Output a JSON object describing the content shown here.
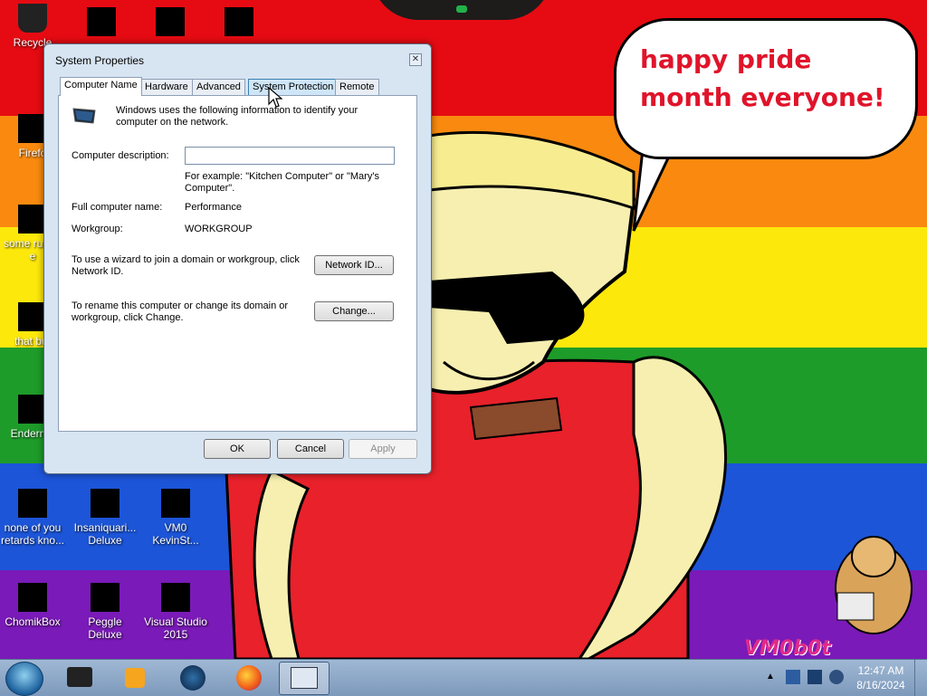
{
  "desktop": {
    "speech_bubble": "happy pride month everyone!",
    "mascot_label": "VM0b0t",
    "icons": [
      {
        "label": "Recycle",
        "name": "desktop-icon-recycle-bin"
      },
      {
        "label": "Firefo",
        "name": "desktop-icon-firefox"
      },
      {
        "label": "some ru ran e",
        "name": "desktop-icon-some-ru"
      },
      {
        "label": "that but",
        "name": "desktop-icon-that-but"
      },
      {
        "label": "Enderma",
        "name": "desktop-icon-enderma"
      },
      {
        "label": "none of you retards kno...",
        "name": "desktop-icon-none-of-you"
      },
      {
        "label": "Insaniquari... Deluxe",
        "name": "desktop-icon-insaniquarium"
      },
      {
        "label": "VM0 KevinSt...",
        "name": "desktop-icon-vm0-kevinst"
      },
      {
        "label": "ChomikBox",
        "name": "desktop-icon-chomikbox"
      },
      {
        "label": "Peggle Deluxe",
        "name": "desktop-icon-peggle"
      },
      {
        "label": "Visual Studio 2015",
        "name": "desktop-icon-visual-studio"
      }
    ]
  },
  "dialog": {
    "title": "System Properties",
    "tabs": [
      "Computer Name",
      "Hardware",
      "Advanced",
      "System Protection",
      "Remote"
    ],
    "intro": "Windows uses the following information to identify your computer on the network.",
    "description_label": "Computer description:",
    "description_value": "",
    "example": "For example: \"Kitchen Computer\" or \"Mary's Computer\".",
    "full_name_label": "Full computer name:",
    "full_name_value": "Performance",
    "workgroup_label": "Workgroup:",
    "workgroup_value": "WORKGROUP",
    "network_id_text": "To use a wizard to join a domain or workgroup, click Network ID.",
    "network_id_button": "Network ID...",
    "rename_text": "To rename this computer or change its domain or workgroup, click Change.",
    "change_button": "Change...",
    "ok_button": "OK",
    "cancel_button": "Cancel",
    "apply_button": "Apply"
  },
  "taskbar": {
    "time": "12:47 AM",
    "date": "8/16/2024"
  },
  "colors": {
    "flag_red": "#e60b12",
    "flag_orange": "#f98a0f",
    "flag_yellow": "#fde80b",
    "flag_green": "#1e9c2a",
    "flag_blue": "#1c55d8",
    "flag_purple": "#7a1ab8",
    "speech_text": "#e0142a"
  }
}
